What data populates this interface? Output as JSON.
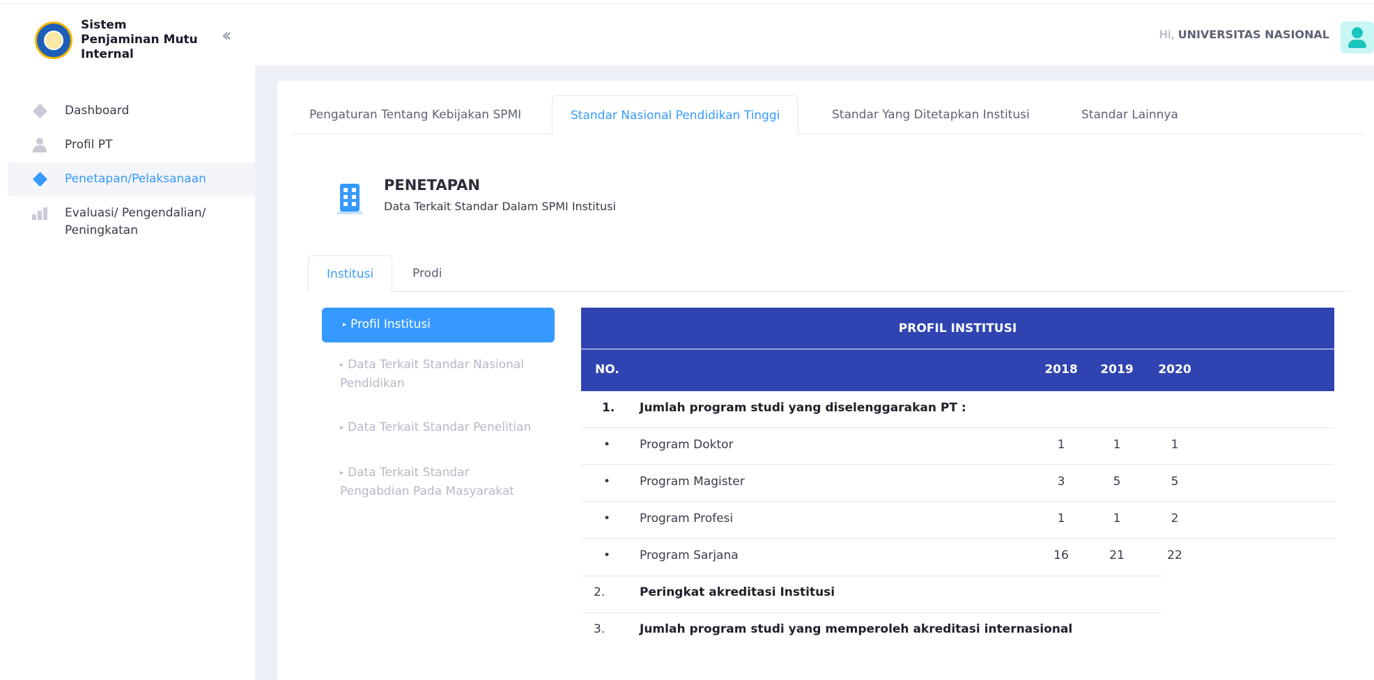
{
  "app": {
    "title": "Sistem Penjaminan Mutu Internal",
    "collapse_icon": "double-chevron-left-icon"
  },
  "sidebar": {
    "items": [
      {
        "label": "Dashboard",
        "icon": "diamond-icon",
        "active": false
      },
      {
        "label": "Profil PT",
        "icon": "person-icon",
        "active": false
      },
      {
        "label": "Penetapan/Pelaksanaan",
        "icon": "diamond-icon",
        "active": true
      },
      {
        "label": "Evaluasi/ Pengendalian/ Peningkatan",
        "icon": "bar-chart-icon",
        "active": false
      }
    ]
  },
  "header": {
    "greeting_prefix": "Hi,",
    "user_name": "UNIVERSITAS NASIONAL",
    "avatar_icon": "user-icon"
  },
  "tabs": [
    {
      "label": "Pengaturan Tentang Kebijakan SPMI",
      "active": false
    },
    {
      "label": "Standar Nasional Pendidikan Tinggi",
      "active": true
    },
    {
      "label": "Standar Yang Ditetapkan Institusi",
      "active": false
    },
    {
      "label": "Standar Lainnya",
      "active": false
    }
  ],
  "section": {
    "icon": "building-icon",
    "title": "PENETAPAN",
    "subtitle": "Data Terkait Standar Dalam SPMI Institusi"
  },
  "subtabs": [
    {
      "label": "Institusi",
      "active": true
    },
    {
      "label": "Prodi",
      "active": false
    }
  ],
  "side_menu": [
    {
      "label": "Profil Institusi",
      "active": true
    },
    {
      "label": "Data Terkait Standar Nasional Pendidikan",
      "active": false
    },
    {
      "label": "Data Terkait Standar Penelitian",
      "active": false
    },
    {
      "label": "Data Terkait Standar Pengabdian Pada Masyarakat",
      "active": false
    }
  ],
  "table": {
    "title": "PROFIL INSTITUSI",
    "col_no": "NO.",
    "years": [
      "2018",
      "2019",
      "2020"
    ],
    "rows": [
      {
        "no": "1.",
        "desc": "Jumlah program studi yang diselenggarakan PT :",
        "bold": true,
        "values": [
          "",
          "",
          ""
        ]
      },
      {
        "no": "•",
        "desc": "Program Doktor",
        "bold": false,
        "values": [
          "1",
          "1",
          "1"
        ]
      },
      {
        "no": "•",
        "desc": "Program Magister",
        "bold": false,
        "values": [
          "3",
          "5",
          "5"
        ]
      },
      {
        "no": "•",
        "desc": "Program Profesi",
        "bold": false,
        "values": [
          "1",
          "1",
          "2"
        ]
      },
      {
        "no": "•",
        "desc": "Program Sarjana",
        "bold": false,
        "values": [
          "16",
          "21",
          "22"
        ]
      },
      {
        "no": "2.",
        "desc": "Peringkat akreditasi Institusi",
        "bold": true,
        "values": [
          "",
          "",
          ""
        ]
      },
      {
        "no": "3.",
        "desc": "Jumlah program studi yang memperoleh akreditasi internasional",
        "bold": true,
        "values": [
          "",
          "",
          ""
        ]
      }
    ]
  },
  "colors": {
    "accent": "#3699ff",
    "table_header": "#2f44b0",
    "content_bg": "#eef0f8"
  }
}
